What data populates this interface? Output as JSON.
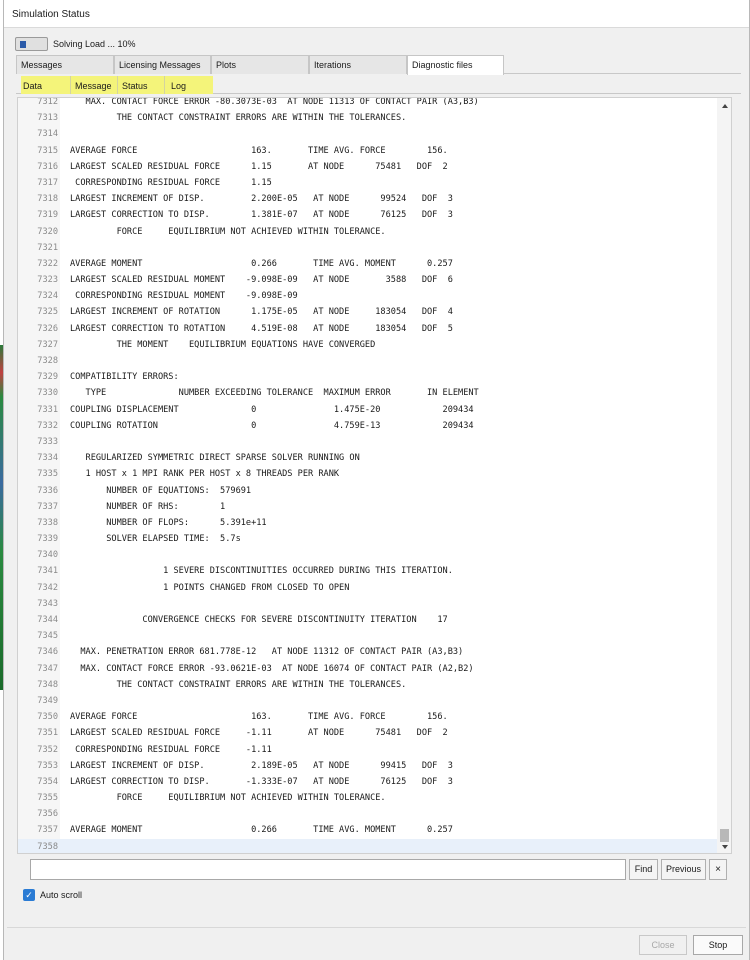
{
  "window": {
    "title": "Simulation Status"
  },
  "progress": {
    "label": "Solving Load ... 10%",
    "value": 0.1,
    "bar_color": "#2a5aa8"
  },
  "tabs": [
    {
      "label": "Messages",
      "active": false
    },
    {
      "label": "Licensing Messages",
      "active": false
    },
    {
      "label": "Plots",
      "active": false
    },
    {
      "label": "Iterations",
      "active": false
    },
    {
      "label": "Diagnostic files",
      "active": true
    }
  ],
  "subtabs": [
    {
      "label": "Data"
    },
    {
      "label": "Message"
    },
    {
      "label": "Status"
    },
    {
      "label": "Log"
    }
  ],
  "highlight_color": "#f4f47a",
  "log_lines": [
    {
      "n": "7312",
      "t": "   MAX. CONTACT FORCE ERROR -80.3073E-03  AT NODE 11313 OF CONTACT PAIR (A3,B3)"
    },
    {
      "n": "7313",
      "t": "         THE CONTACT CONSTRAINT ERRORS ARE WITHIN THE TOLERANCES."
    },
    {
      "n": "7314",
      "t": ""
    },
    {
      "n": "7315",
      "t": "AVERAGE FORCE                      163.       TIME AVG. FORCE        156."
    },
    {
      "n": "7316",
      "t": "LARGEST SCALED RESIDUAL FORCE      1.15       AT NODE      75481   DOF  2"
    },
    {
      "n": "7317",
      "t": " CORRESPONDING RESIDUAL FORCE      1.15"
    },
    {
      "n": "7318",
      "t": "LARGEST INCREMENT OF DISP.         2.200E-05   AT NODE      99524   DOF  3"
    },
    {
      "n": "7319",
      "t": "LARGEST CORRECTION TO DISP.        1.381E-07   AT NODE      76125   DOF  3"
    },
    {
      "n": "7320",
      "t": "         FORCE     EQUILIBRIUM NOT ACHIEVED WITHIN TOLERANCE."
    },
    {
      "n": "7321",
      "t": ""
    },
    {
      "n": "7322",
      "t": "AVERAGE MOMENT                     0.266       TIME AVG. MOMENT      0.257"
    },
    {
      "n": "7323",
      "t": "LARGEST SCALED RESIDUAL MOMENT    -9.098E-09   AT NODE       3588   DOF  6"
    },
    {
      "n": "7324",
      "t": " CORRESPONDING RESIDUAL MOMENT    -9.098E-09"
    },
    {
      "n": "7325",
      "t": "LARGEST INCREMENT OF ROTATION      1.175E-05   AT NODE     183054   DOF  4"
    },
    {
      "n": "7326",
      "t": "LARGEST CORRECTION TO ROTATION     4.519E-08   AT NODE     183054   DOF  5"
    },
    {
      "n": "7327",
      "t": "         THE MOMENT    EQUILIBRIUM EQUATIONS HAVE CONVERGED"
    },
    {
      "n": "7328",
      "t": ""
    },
    {
      "n": "7329",
      "t": "COMPATIBILITY ERRORS:"
    },
    {
      "n": "7330",
      "t": "   TYPE              NUMBER EXCEEDING TOLERANCE  MAXIMUM ERROR       IN ELEMENT"
    },
    {
      "n": "7331",
      "t": "COUPLING DISPLACEMENT              0               1.475E-20            209434"
    },
    {
      "n": "7332",
      "t": "COUPLING ROTATION                  0               4.759E-13            209434"
    },
    {
      "n": "7333",
      "t": ""
    },
    {
      "n": "7334",
      "t": "   REGULARIZED SYMMETRIC DIRECT SPARSE SOLVER RUNNING ON"
    },
    {
      "n": "7335",
      "t": "   1 HOST x 1 MPI RANK PER HOST x 8 THREADS PER RANK"
    },
    {
      "n": "7336",
      "t": "       NUMBER OF EQUATIONS:  579691"
    },
    {
      "n": "7337",
      "t": "       NUMBER OF RHS:        1"
    },
    {
      "n": "7338",
      "t": "       NUMBER OF FLOPS:      5.391e+11"
    },
    {
      "n": "7339",
      "t": "       SOLVER ELAPSED TIME:  5.7s"
    },
    {
      "n": "7340",
      "t": ""
    },
    {
      "n": "7341",
      "t": "                  1 SEVERE DISCONTINUITIES OCCURRED DURING THIS ITERATION."
    },
    {
      "n": "7342",
      "t": "                  1 POINTS CHANGED FROM CLOSED TO OPEN"
    },
    {
      "n": "7343",
      "t": ""
    },
    {
      "n": "7344",
      "t": "              CONVERGENCE CHECKS FOR SEVERE DISCONTINUITY ITERATION    17"
    },
    {
      "n": "7345",
      "t": ""
    },
    {
      "n": "7346",
      "t": "  MAX. PENETRATION ERROR 681.778E-12   AT NODE 11312 OF CONTACT PAIR (A3,B3)"
    },
    {
      "n": "7347",
      "t": "  MAX. CONTACT FORCE ERROR -93.0621E-03  AT NODE 16074 OF CONTACT PAIR (A2,B2)"
    },
    {
      "n": "7348",
      "t": "         THE CONTACT CONSTRAINT ERRORS ARE WITHIN THE TOLERANCES."
    },
    {
      "n": "7349",
      "t": ""
    },
    {
      "n": "7350",
      "t": "AVERAGE FORCE                      163.       TIME AVG. FORCE        156."
    },
    {
      "n": "7351",
      "t": "LARGEST SCALED RESIDUAL FORCE     -1.11       AT NODE      75481   DOF  2"
    },
    {
      "n": "7352",
      "t": " CORRESPONDING RESIDUAL FORCE     -1.11"
    },
    {
      "n": "7353",
      "t": "LARGEST INCREMENT OF DISP.         2.189E-05   AT NODE      99415   DOF  3"
    },
    {
      "n": "7354",
      "t": "LARGEST CORRECTION TO DISP.       -1.333E-07   AT NODE      76125   DOF  3"
    },
    {
      "n": "7355",
      "t": "         FORCE     EQUILIBRIUM NOT ACHIEVED WITHIN TOLERANCE."
    },
    {
      "n": "7356",
      "t": ""
    },
    {
      "n": "7357",
      "t": "AVERAGE MOMENT                     0.266       TIME AVG. MOMENT      0.257"
    },
    {
      "n": "7358",
      "t": ""
    }
  ],
  "find": {
    "value": "",
    "find_label": "Find",
    "previous_label": "Previous",
    "close_glyph": "×"
  },
  "auto_scroll": {
    "label": "Auto scroll",
    "checked": true,
    "check_glyph": "✓"
  },
  "footer": {
    "close_label": "Close",
    "stop_label": "Stop"
  }
}
